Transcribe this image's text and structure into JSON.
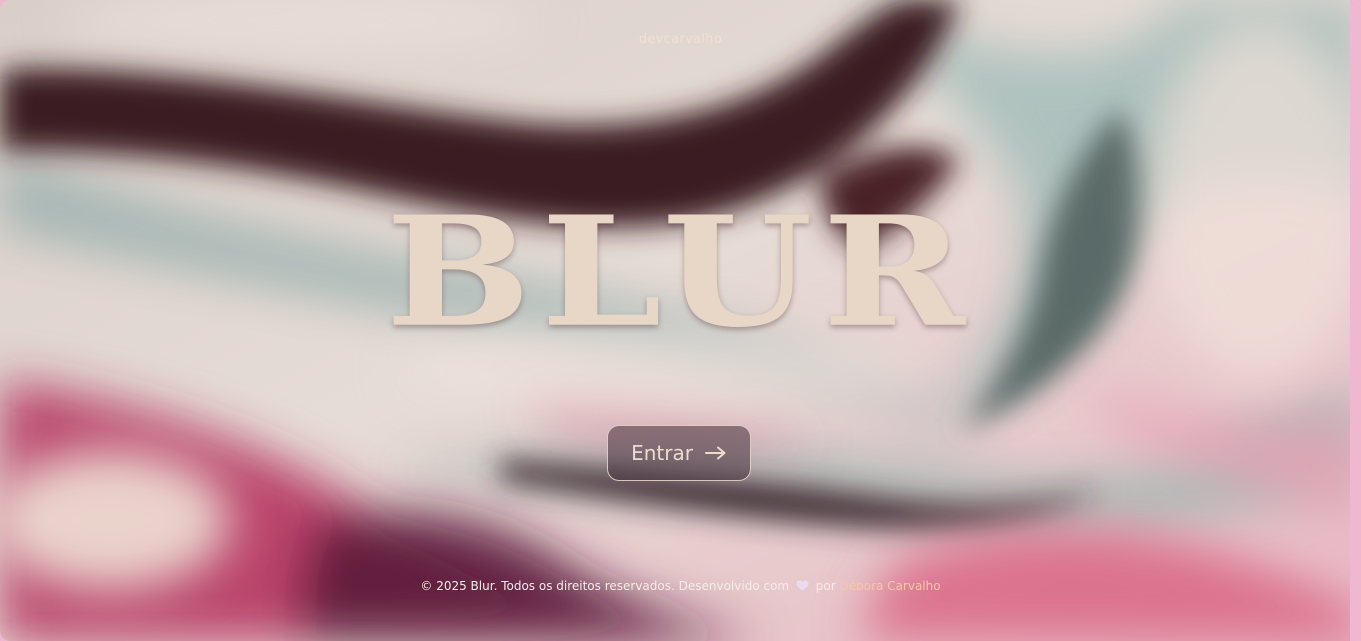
{
  "header": {
    "brand": "devcarvalho"
  },
  "hero": {
    "title": "BLUR"
  },
  "actions": {
    "enter_label": "Entrar",
    "enter_icon": "arrow-right-icon"
  },
  "footer": {
    "text_before": "© 2025 Blur. Todos os direitos reservados. Desenvolvido com",
    "heart_icon": "heart-icon",
    "text_between": "por",
    "author": "Débora Carvalho"
  },
  "colors": {
    "title": "#e8d6c6",
    "author_accent": "#f7c7a6",
    "deep_plum": "#3a1a22",
    "teal_grey": "#8fa8a4",
    "magenta": "#c2325e",
    "blush": "#eec2cc"
  }
}
